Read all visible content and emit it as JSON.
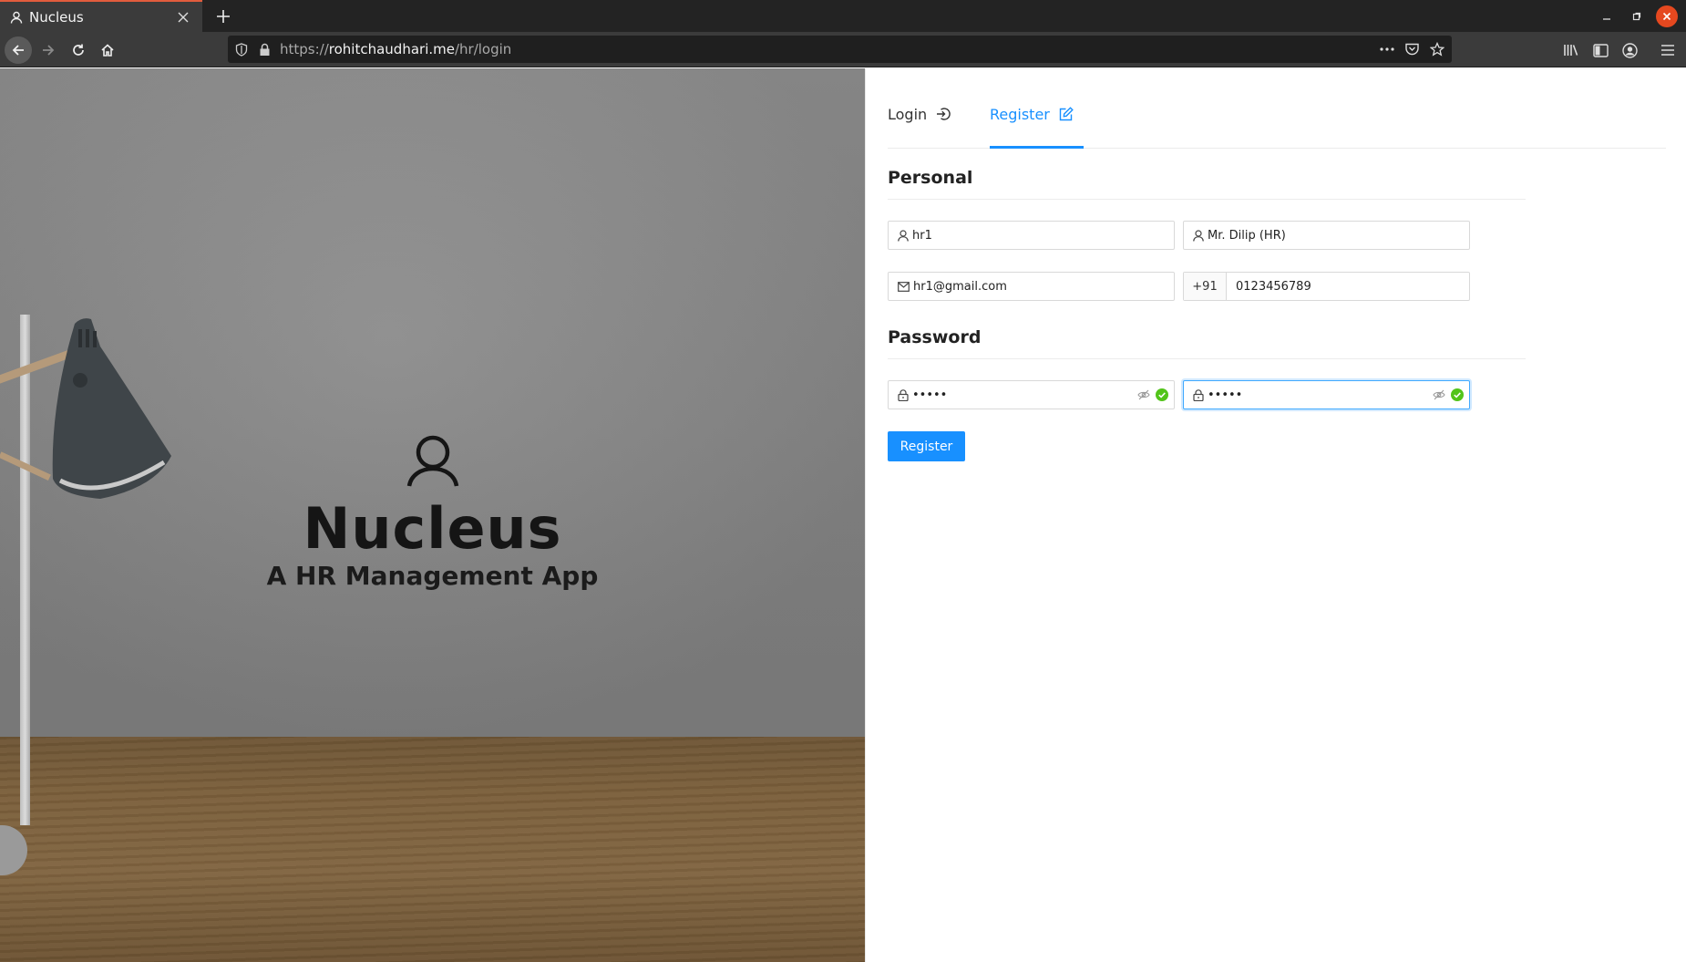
{
  "browser": {
    "tab_title": "Nucleus",
    "url_prefix": "https://",
    "url_host": "rohitchaudhari.me",
    "url_path": "/hr/login"
  },
  "hero": {
    "icon": "user-outline-icon",
    "title": "Nucleus",
    "subtitle": "A HR Management App"
  },
  "auth_tabs": [
    {
      "label": "Login",
      "icon": "login-icon",
      "active": false
    },
    {
      "label": "Register",
      "icon": "edit-icon",
      "active": true
    }
  ],
  "personal": {
    "heading": "Personal",
    "username": "hr1",
    "full_name": "Mr. Dilip (HR)",
    "email": "hr1@gmail.com",
    "phone_prefix": "+91",
    "phone": "0123456789"
  },
  "password": {
    "heading": "Password",
    "password_mask": "•••••",
    "confirm_mask": "•••••",
    "status_color": "#52c41a"
  },
  "actions": {
    "register_label": "Register"
  },
  "colors": {
    "primary": "#1890ff",
    "success": "#52c41a"
  }
}
